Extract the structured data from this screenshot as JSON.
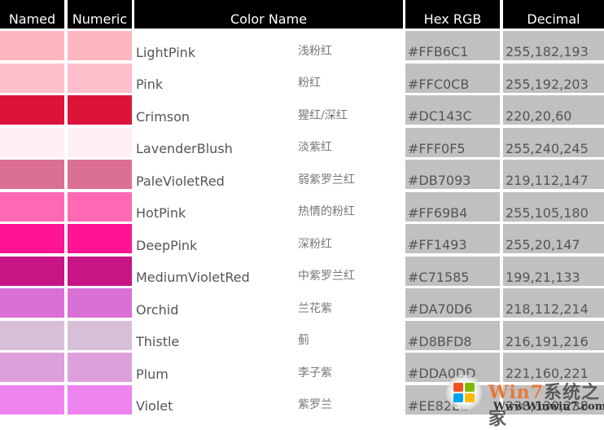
{
  "headers": {
    "named": "Named",
    "numeric": "Numeric",
    "color_name": "Color Name",
    "hex": "Hex RGB",
    "decimal": "Decimal"
  },
  "rows": [
    {
      "name": "LightPink",
      "name_cn": "浅粉红",
      "hex": "#FFB6C1",
      "decimal": "255,182,193",
      "color": "#FFB6C1"
    },
    {
      "name": "Pink",
      "name_cn": "粉红",
      "hex": "#FFC0CB",
      "decimal": "255,192,203",
      "color": "#FFC0CB"
    },
    {
      "name": "Crimson",
      "name_cn": "猩红/深红",
      "hex": "#DC143C",
      "decimal": "220,20,60",
      "color": "#DC143C"
    },
    {
      "name": "LavenderBlush",
      "name_cn": "淡紫红",
      "hex": "#FFF0F5",
      "decimal": "255,240,245",
      "color": "#FFF0F5"
    },
    {
      "name": "PaleVioletRed",
      "name_cn": "弱紫罗兰红",
      "hex": "#DB7093",
      "decimal": "219,112,147",
      "color": "#DB7093"
    },
    {
      "name": "HotPink",
      "name_cn": "热情的粉红",
      "hex": "#FF69B4",
      "decimal": "255,105,180",
      "color": "#FF69B4"
    },
    {
      "name": "DeepPink",
      "name_cn": "深粉红",
      "hex": "#FF1493",
      "decimal": "255,20,147",
      "color": "#FF1493"
    },
    {
      "name": "MediumVioletRed",
      "name_cn": "中紫罗兰红",
      "hex": "#C71585",
      "decimal": "199,21,133",
      "color": "#C71585"
    },
    {
      "name": "Orchid",
      "name_cn": "兰花紫",
      "hex": "#DA70D6",
      "decimal": "218,112,214",
      "color": "#DA70D6"
    },
    {
      "name": "Thistle",
      "name_cn": "蓟",
      "hex": "#D8BFD8",
      "decimal": "216,191,216",
      "color": "#D8BFD8"
    },
    {
      "name": "Plum",
      "name_cn": "李子紫",
      "hex": "#DDA0DD",
      "decimal": "221,160,221",
      "color": "#DDA0DD"
    },
    {
      "name": "Violet",
      "name_cn": "紫罗兰",
      "hex": "#EE82EE",
      "decimal": "238,130,238",
      "color": "#EE82EE"
    }
  ],
  "watermark": {
    "title_latin": "Win7",
    "title_cn": "系统之家",
    "url": "Www.Winwin7.com"
  }
}
